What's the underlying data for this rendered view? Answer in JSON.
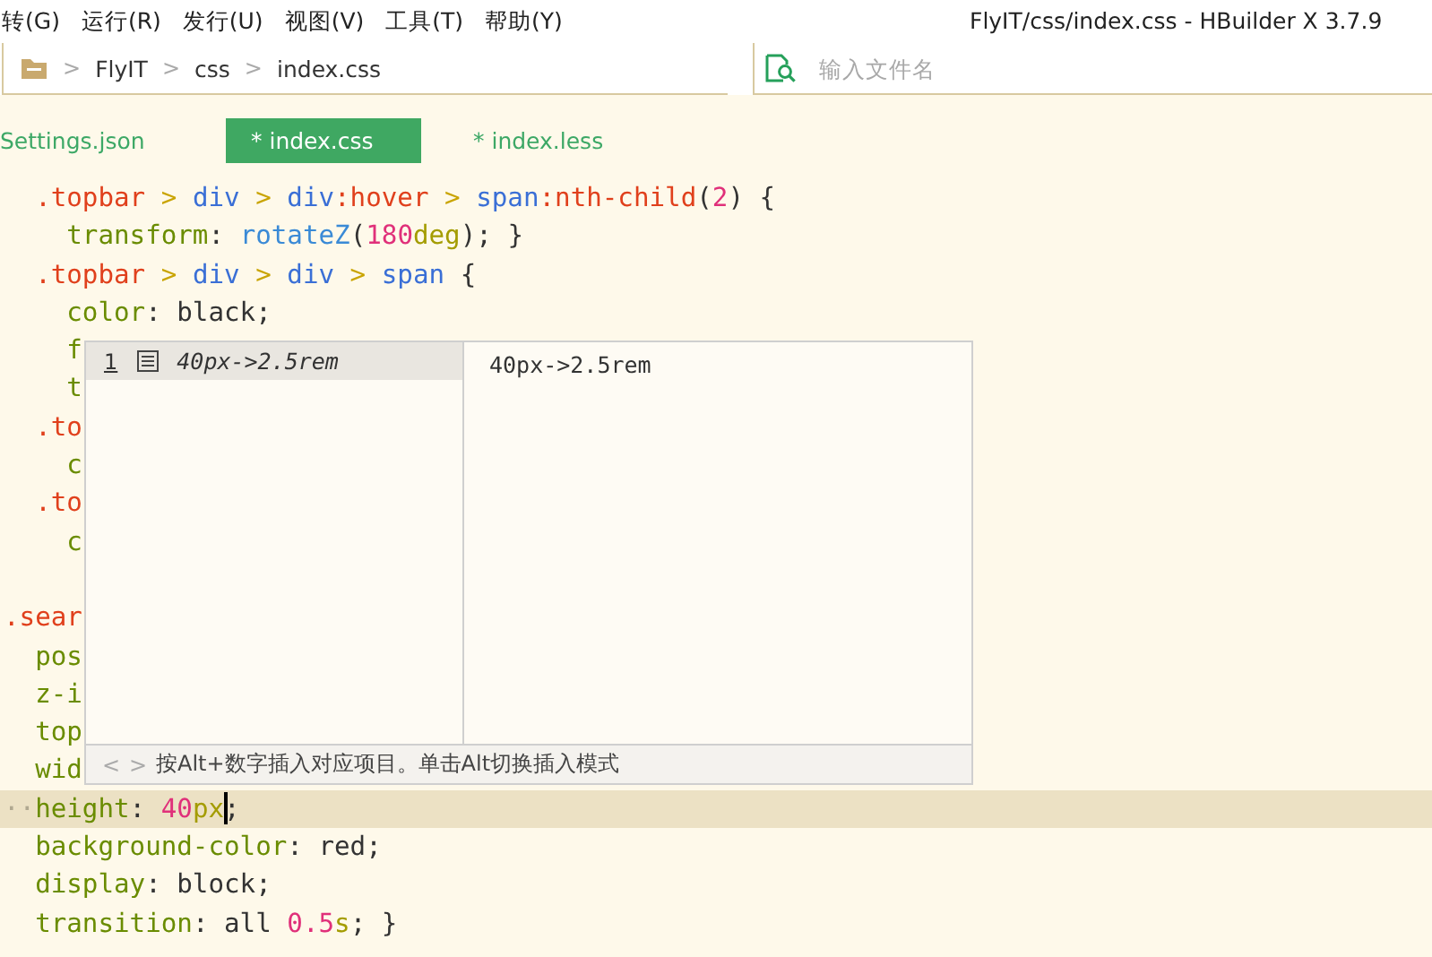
{
  "menu": {
    "items": [
      "转(G)",
      "运行(R)",
      "发行(U)",
      "视图(V)",
      "工具(T)",
      "帮助(Y)"
    ]
  },
  "window": {
    "title": "FlyIT/css/index.css - HBuilder X 3.7.9"
  },
  "breadcrumb": {
    "separator": ">",
    "items": [
      "FlyIT",
      "css",
      "index.css"
    ]
  },
  "file_search": {
    "placeholder": "输入文件名"
  },
  "tabs": [
    {
      "label": "Settings.json",
      "selected": false
    },
    {
      "label": "* index.css",
      "selected": true
    },
    {
      "label": "* index.less",
      "selected": false
    }
  ],
  "editor": {
    "lines": [
      {
        "kind": "code",
        "current": false,
        "tokens": [
          {
            "kind": "sel",
            "text": "  .topbar"
          },
          {
            "kind": "comb",
            "text": " > "
          },
          {
            "kind": "tag",
            "text": "div"
          },
          {
            "kind": "comb",
            "text": " > "
          },
          {
            "kind": "tag",
            "text": "div"
          },
          {
            "kind": "sel",
            "text": ":hover"
          },
          {
            "kind": "comb",
            "text": " > "
          },
          {
            "kind": "tag",
            "text": "span"
          },
          {
            "kind": "sel",
            "text": ":nth-child"
          },
          {
            "kind": "plain",
            "text": "("
          },
          {
            "kind": "num",
            "text": "2"
          },
          {
            "kind": "plain",
            "text": ") {"
          }
        ]
      },
      {
        "kind": "code",
        "current": false,
        "tokens": [
          {
            "kind": "prop",
            "text": "    transform"
          },
          {
            "kind": "plain",
            "text": ": "
          },
          {
            "kind": "fn",
            "text": "rotateZ"
          },
          {
            "kind": "plain",
            "text": "("
          },
          {
            "kind": "num",
            "text": "180"
          },
          {
            "kind": "unit",
            "text": "deg"
          },
          {
            "kind": "plain",
            "text": "); }"
          }
        ]
      },
      {
        "kind": "code",
        "current": false,
        "tokens": [
          {
            "kind": "sel",
            "text": "  .topbar"
          },
          {
            "kind": "comb",
            "text": " > "
          },
          {
            "kind": "tag",
            "text": "div"
          },
          {
            "kind": "comb",
            "text": " > "
          },
          {
            "kind": "tag",
            "text": "div"
          },
          {
            "kind": "comb",
            "text": " > "
          },
          {
            "kind": "tag",
            "text": "span"
          },
          {
            "kind": "plain",
            "text": " {"
          }
        ]
      },
      {
        "kind": "code",
        "current": false,
        "tokens": [
          {
            "kind": "prop",
            "text": "    color"
          },
          {
            "kind": "plain",
            "text": ": black;"
          }
        ]
      },
      {
        "kind": "code",
        "current": false,
        "tokens": [
          {
            "kind": "prop",
            "text": "    f"
          }
        ]
      },
      {
        "kind": "code",
        "current": false,
        "tokens": [
          {
            "kind": "prop",
            "text": "    t"
          }
        ]
      },
      {
        "kind": "code",
        "current": false,
        "tokens": [
          {
            "kind": "sel",
            "text": "  .to"
          }
        ]
      },
      {
        "kind": "code",
        "current": false,
        "tokens": [
          {
            "kind": "prop",
            "text": "    c"
          }
        ]
      },
      {
        "kind": "code",
        "current": false,
        "tokens": [
          {
            "kind": "sel",
            "text": "  .to"
          }
        ]
      },
      {
        "kind": "code",
        "current": false,
        "tokens": [
          {
            "kind": "prop",
            "text": "    c"
          }
        ]
      },
      {
        "kind": "blank",
        "current": false
      },
      {
        "kind": "code",
        "current": false,
        "tokens": [
          {
            "kind": "sel",
            "text": ".sear"
          }
        ]
      },
      {
        "kind": "code",
        "current": false,
        "tokens": [
          {
            "kind": "prop",
            "text": "  pos"
          }
        ]
      },
      {
        "kind": "code",
        "current": false,
        "tokens": [
          {
            "kind": "prop",
            "text": "  z-i"
          }
        ]
      },
      {
        "kind": "code",
        "current": false,
        "tokens": [
          {
            "kind": "prop",
            "text": "  top"
          }
        ]
      },
      {
        "kind": "code",
        "current": false,
        "tokens": [
          {
            "kind": "prop",
            "text": "  wid"
          }
        ]
      },
      {
        "kind": "code",
        "current": true,
        "tokens": [
          {
            "kind": "space",
            "text": "··"
          },
          {
            "kind": "prop",
            "text": "height"
          },
          {
            "kind": "plain",
            "text": ": "
          },
          {
            "kind": "num",
            "text": "40"
          },
          {
            "kind": "unit",
            "text": "px"
          },
          {
            "kind": "caret"
          },
          {
            "kind": "plain",
            "text": ";"
          }
        ]
      },
      {
        "kind": "code",
        "current": false,
        "tokens": [
          {
            "kind": "prop",
            "text": "  background-color"
          },
          {
            "kind": "plain",
            "text": ": red;"
          }
        ]
      },
      {
        "kind": "code",
        "current": false,
        "tokens": [
          {
            "kind": "prop",
            "text": "  display"
          },
          {
            "kind": "plain",
            "text": ": block;"
          }
        ]
      },
      {
        "kind": "code",
        "current": false,
        "tokens": [
          {
            "kind": "prop",
            "text": "  transition"
          },
          {
            "kind": "plain",
            "text": ": all "
          },
          {
            "kind": "num",
            "text": "0.5"
          },
          {
            "kind": "unit",
            "text": "s"
          },
          {
            "kind": "plain",
            "text": "; }"
          }
        ]
      }
    ]
  },
  "completion": {
    "items": [
      {
        "number": "1",
        "label": "40px->2.5rem",
        "selected": true
      }
    ],
    "detail": "40px->2.5rem",
    "nav": [
      "<",
      ">"
    ],
    "hint": "按Alt+数字插入对应项目。单击Alt切换插入模式"
  }
}
